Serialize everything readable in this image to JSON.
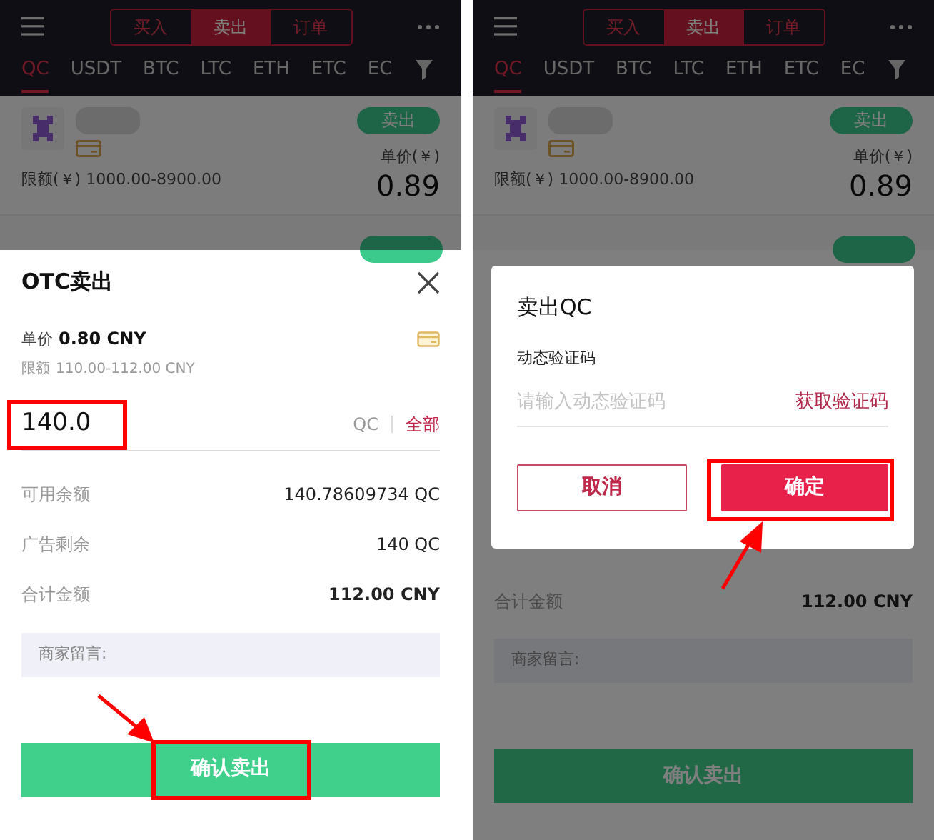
{
  "screens": [
    {
      "header": {
        "tabs": [
          {
            "label": "买入",
            "selected": false
          },
          {
            "label": "卖出",
            "selected": true
          },
          {
            "label": "订单",
            "selected": false
          }
        ]
      },
      "coins": [
        {
          "label": "QC",
          "selected": true
        },
        {
          "label": "USDT",
          "selected": false
        },
        {
          "label": "BTC",
          "selected": false
        },
        {
          "label": "LTC",
          "selected": false
        },
        {
          "label": "ETH",
          "selected": false
        },
        {
          "label": "ETC",
          "selected": false
        },
        {
          "label": "EC",
          "selected": false
        }
      ],
      "ad": {
        "action": "卖出",
        "limit": "限额(￥) 1000.00-8900.00",
        "price_label": "单价(￥)",
        "price": "0.89"
      },
      "sheet": {
        "title": "OTC卖出",
        "price_label": "单价",
        "price": "0.80 CNY",
        "limit_label": "限额",
        "limit": "110.00-112.00 CNY",
        "amount": {
          "value": "140.0",
          "boxed": true
        },
        "currency": "QC",
        "all_link": "全部",
        "rows": [
          {
            "label": "可用余额",
            "value": "140.78609734 QC",
            "bold": false
          },
          {
            "label": "广告剩余",
            "value": "140 QC",
            "bold": false
          },
          {
            "label": "合计金额",
            "value": "112.00 CNY",
            "bold": true
          }
        ],
        "message_placeholder": "商家留言:",
        "submit": {
          "label": "确认卖出",
          "boxed": true,
          "arrow": true
        }
      }
    },
    {
      "header": {
        "tabs": [
          {
            "label": "买入",
            "selected": false
          },
          {
            "label": "卖出",
            "selected": true
          },
          {
            "label": "订单",
            "selected": false
          }
        ]
      },
      "coins": [
        {
          "label": "QC",
          "selected": true
        },
        {
          "label": "USDT",
          "selected": false
        },
        {
          "label": "BTC",
          "selected": false
        },
        {
          "label": "LTC",
          "selected": false
        },
        {
          "label": "ETH",
          "selected": false
        },
        {
          "label": "ETC",
          "selected": false
        },
        {
          "label": "EC",
          "selected": false
        }
      ],
      "ad": {
        "action": "卖出",
        "limit": "限额(￥) 1000.00-8900.00",
        "price_label": "单价(￥)",
        "price": "0.89"
      },
      "sheet": {
        "rows": [
          {
            "label": "合计金额",
            "value": "112.00 CNY",
            "bold": true
          }
        ],
        "message_placeholder": "商家留言:",
        "submit": {
          "label": "确认卖出"
        }
      },
      "dialog": {
        "title": "卖出QC",
        "field_label": "动态验证码",
        "placeholder": "请输入动态验证码",
        "code_link": "获取验证码",
        "cancel": "取消",
        "confirm": {
          "label": "确定",
          "boxed": true,
          "arrow": true
        }
      }
    }
  ]
}
